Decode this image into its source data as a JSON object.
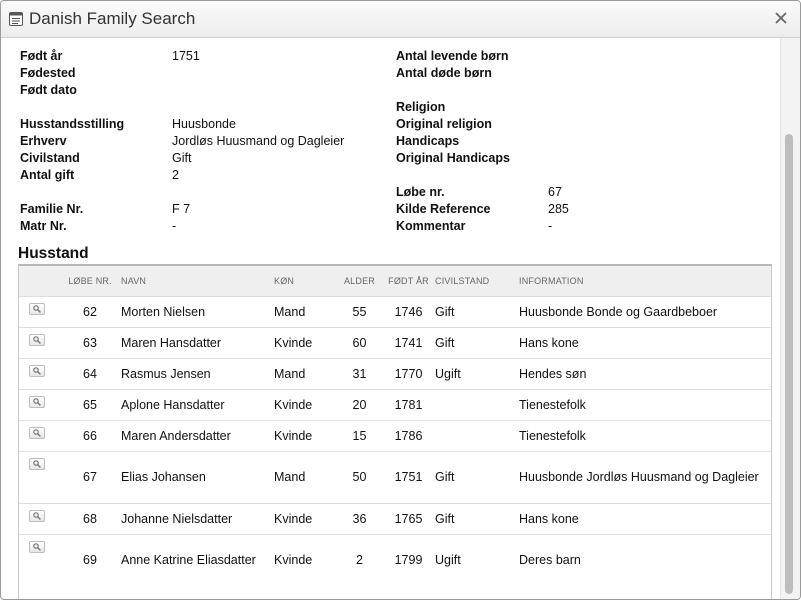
{
  "window": {
    "title": "Danish Family Search"
  },
  "fields": {
    "fodt_aar": {
      "label": "Født år",
      "value": "1751"
    },
    "fodested": {
      "label": "Fødested",
      "value": ""
    },
    "fodt_dato": {
      "label": "Født dato",
      "value": ""
    },
    "husstandsstilling": {
      "label": "Husstandsstilling",
      "value": "Huusbonde"
    },
    "erhverv": {
      "label": "Erhverv",
      "value": "Jordløs Huusmand og Dagleier"
    },
    "civilstand": {
      "label": "Civilstand",
      "value": "Gift"
    },
    "antal_gift": {
      "label": "Antal gift",
      "value": "2"
    },
    "familie_nr": {
      "label": "Familie Nr.",
      "value": "F 7"
    },
    "matr_nr": {
      "label": "Matr Nr.",
      "value": "-"
    },
    "antal_levende": {
      "label": "Antal levende børn",
      "value": ""
    },
    "antal_dode": {
      "label": "Antal døde børn",
      "value": ""
    },
    "religion": {
      "label": "Religion",
      "value": ""
    },
    "original_religion": {
      "label": "Original religion",
      "value": ""
    },
    "handicaps": {
      "label": "Handicaps",
      "value": ""
    },
    "original_handicaps": {
      "label": "Original Handicaps",
      "value": ""
    },
    "lobe_nr": {
      "label": "Løbe nr.",
      "value": "67"
    },
    "kilde_reference": {
      "label": "Kilde Reference",
      "value": "285"
    },
    "kommentar": {
      "label": "Kommentar",
      "value": "-"
    }
  },
  "household": {
    "title": "Husstand",
    "headers": [
      "LØBE NR.",
      "NAVN",
      "KØN",
      "ALDER",
      "FØDT ÅR",
      "CIVILSTAND",
      "INFORMATION"
    ],
    "rows": [
      {
        "nr": "62",
        "navn": "Morten Nielsen",
        "kon": "Mand",
        "alder": "55",
        "fodt": "1746",
        "civil": "Gift",
        "info": "Huusbonde Bonde og Gaardbeboer"
      },
      {
        "nr": "63",
        "navn": "Maren Hansdatter",
        "kon": "Kvinde",
        "alder": "60",
        "fodt": "1741",
        "civil": "Gift",
        "info": "Hans kone"
      },
      {
        "nr": "64",
        "navn": "Rasmus Jensen",
        "kon": "Mand",
        "alder": "31",
        "fodt": "1770",
        "civil": "Ugift",
        "info": "Hendes søn"
      },
      {
        "nr": "65",
        "navn": "Aplone Hansdatter",
        "kon": "Kvinde",
        "alder": "20",
        "fodt": "1781",
        "civil": "",
        "info": "Tienestefolk"
      },
      {
        "nr": "66",
        "navn": "Maren Andersdatter",
        "kon": "Kvinde",
        "alder": "15",
        "fodt": "1786",
        "civil": "",
        "info": "Tienestefolk"
      },
      {
        "nr": "67",
        "navn": "Elias Johansen",
        "kon": "Mand",
        "alder": "50",
        "fodt": "1751",
        "civil": "Gift",
        "info": "Huusbonde Jordløs Huusmand og Dagleier"
      },
      {
        "nr": "68",
        "navn": "Johanne Nielsdatter",
        "kon": "Kvinde",
        "alder": "36",
        "fodt": "1765",
        "civil": "Gift",
        "info": "Hans kone"
      },
      {
        "nr": "69",
        "navn": "Anne Katrine Eliasdatter",
        "kon": "Kvinde",
        "alder": "2",
        "fodt": "1799",
        "civil": "Ugift",
        "info": "Deres barn"
      }
    ]
  }
}
